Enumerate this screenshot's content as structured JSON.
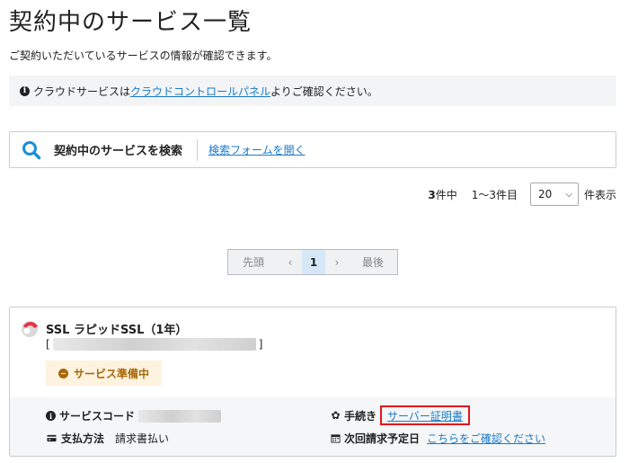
{
  "page": {
    "title": "契約中のサービス一覧",
    "intro": "ご契約いただいているサービスの情報が確認できます。"
  },
  "notice": {
    "prefix": "クラウドサービスは",
    "link": "クラウドコントロールパネル",
    "suffix": "よりご確認ください。"
  },
  "search": {
    "label": "契約中のサービスを検索",
    "open_link": "検索フォームを開く"
  },
  "results": {
    "count": "3",
    "count_unit": "件中",
    "range": "1〜3件目",
    "per_page": "20",
    "per_page_label": "件表示"
  },
  "pagination": {
    "first": "先頭",
    "prev": "‹",
    "current": "1",
    "next": "›",
    "last": "最後"
  },
  "service": {
    "name": "SSL ラピッドSSL（1年）",
    "bracket_open": "[",
    "bracket_close": "]",
    "status": "サービス準備中",
    "code_label": "サービスコード",
    "payment_label": "支払方法",
    "payment_value": "請求書払い",
    "procedure_label": "手続き",
    "procedure_link": "サーバー証明書",
    "next_billing_label": "次回請求予定日",
    "next_billing_link": "こちらをご確認ください"
  },
  "colors": {
    "link": "#1a7ac8",
    "search_icon": "#1a8fd6",
    "status_bg": "#fdf3de",
    "status_text": "#a8680a",
    "highlight_border": "#e3151a"
  }
}
